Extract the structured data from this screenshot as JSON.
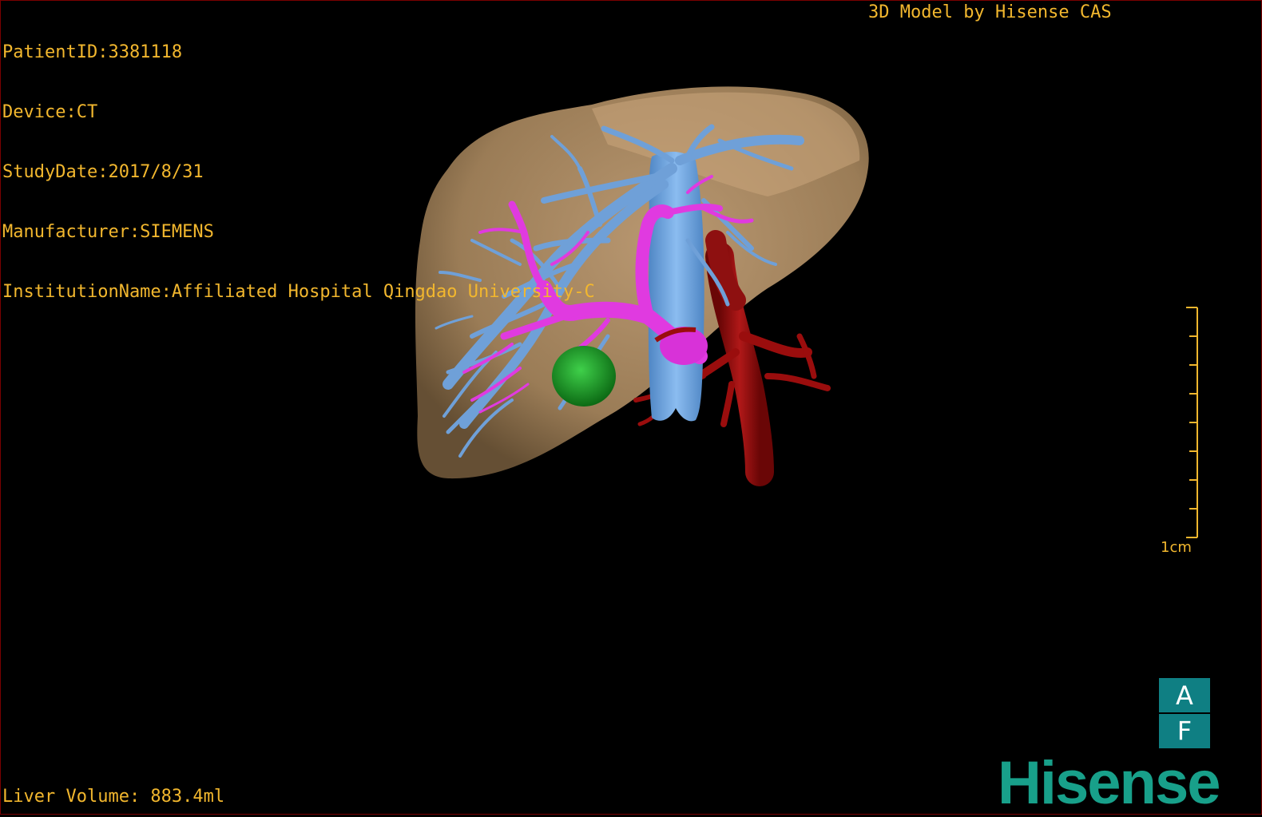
{
  "overlay": {
    "patient_id": "PatientID:3381118",
    "device": "Device:CT",
    "study_date": "StudyDate:2017/8/31",
    "manufacturer": "Manufacturer:SIEMENS",
    "institution": "InstitutionName:Affiliated Hospital Qingdao University-C",
    "model_credit": "3D Model by Hisense CAS",
    "liver_volume": "Liver Volume: 883.4ml"
  },
  "scale_bar": {
    "label": "1cm",
    "tick_count": 9
  },
  "orientation_cube": {
    "top": "A",
    "bottom": "F"
  },
  "brand": {
    "logo": "Hisense"
  },
  "colors": {
    "overlay_text": "#f2b72e",
    "liver": "#b8956a",
    "hepatic_vein": "#6fa0d8",
    "portal_vein": "#e03ae0",
    "artery_aorta": "#9a0d0d",
    "lesion": "#1a9a24",
    "orientation_box": "#0f7f83",
    "logo": "#18a08a"
  }
}
